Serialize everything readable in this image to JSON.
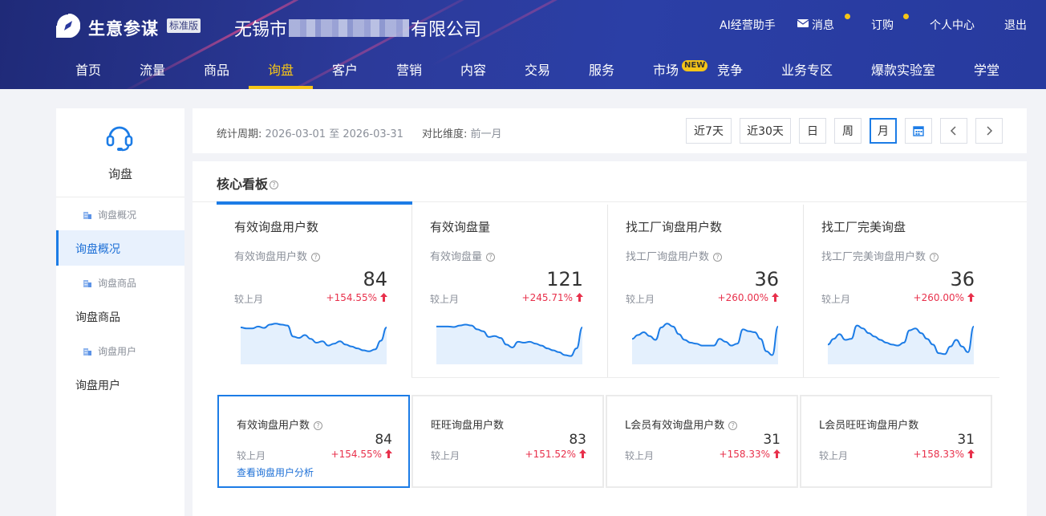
{
  "header": {
    "brand": "生意参谋",
    "edition": "标准版",
    "company_prefix": "无锡市",
    "company_suffix": "有限公司",
    "right": {
      "ai": "AI经营助手",
      "messages": "消息",
      "order": "订购",
      "personal": "个人中心",
      "logout": "退出"
    }
  },
  "nav": {
    "items": [
      "首页",
      "流量",
      "商品",
      "询盘",
      "客户",
      "营销",
      "内容",
      "交易",
      "服务",
      "市场",
      "竞争",
      "业务专区",
      "爆款实验室",
      "学堂"
    ],
    "active": "询盘",
    "new_badge": "NEW"
  },
  "sidebar": {
    "title": "询盘",
    "items": [
      {
        "label": "询盘概况",
        "type": "sub"
      },
      {
        "label": "询盘概况",
        "type": "main",
        "active": true
      },
      {
        "label": "询盘商品",
        "type": "sub"
      },
      {
        "label": "询盘商品",
        "type": "main"
      },
      {
        "label": "询盘用户",
        "type": "sub"
      },
      {
        "label": "询盘用户",
        "type": "main"
      }
    ]
  },
  "filter": {
    "period_label": "统计周期:",
    "period_value": "2026-03-01 至 2026-03-31",
    "compare_label": "对比维度:",
    "compare_value": "前一月",
    "buttons": [
      "近7天",
      "近30天",
      "日",
      "周",
      "月"
    ],
    "active_button": "月"
  },
  "core": {
    "title": "核心看板",
    "cards": [
      {
        "title": "有效询盘用户数",
        "subtitle": "有效询盘用户数",
        "value": "84",
        "compare_label": "较上月",
        "change": "+154.55%",
        "trend": [
          0.74,
          0.72,
          0.72,
          0.76,
          0.73,
          0.8,
          0.82,
          0.8,
          0.78,
          0.55,
          0.52,
          0.58,
          0.5,
          0.42,
          0.45,
          0.36,
          0.4,
          0.45,
          0.38,
          0.34,
          0.3,
          0.26,
          0.24,
          0.28,
          0.46,
          0.74
        ]
      },
      {
        "title": "有效询盘量",
        "subtitle": "有效询盘量",
        "value": "121",
        "compare_label": "较上月",
        "change": "+245.71%",
        "trend": [
          0.76,
          0.76,
          0.76,
          0.75,
          0.78,
          0.8,
          0.78,
          0.7,
          0.66,
          0.54,
          0.56,
          0.52,
          0.38,
          0.32,
          0.44,
          0.42,
          0.44,
          0.4,
          0.36,
          0.3,
          0.26,
          0.22,
          0.16,
          0.14,
          0.3,
          0.74
        ]
      },
      {
        "title": "找工厂询盘用户数",
        "subtitle": "找工厂询盘用户数",
        "value": "36",
        "compare_label": "较上月",
        "change": "+260.00%",
        "trend": [
          0.5,
          0.58,
          0.64,
          0.56,
          0.48,
          0.74,
          0.82,
          0.76,
          0.6,
          0.48,
          0.42,
          0.4,
          0.36,
          0.36,
          0.36,
          0.5,
          0.44,
          0.36,
          0.4,
          0.7,
          0.66,
          0.64,
          0.5,
          0.24,
          0.16,
          0.76
        ]
      },
      {
        "title": "找工厂完美询盘",
        "subtitle": "找工厂完美询盘用户数",
        "value": "36",
        "compare_label": "较上月",
        "change": "+260.00%",
        "trend": [
          0.38,
          0.5,
          0.6,
          0.48,
          0.5,
          0.78,
          0.72,
          0.62,
          0.55,
          0.48,
          0.42,
          0.38,
          0.36,
          0.42,
          0.68,
          0.72,
          0.62,
          0.5,
          0.38,
          0.2,
          0.18,
          0.34,
          0.48,
          0.34,
          0.22,
          0.76
        ]
      }
    ]
  },
  "small_cards": [
    {
      "title": "有效询盘用户数",
      "value": "84",
      "compare_label": "较上月",
      "change": "+154.55%",
      "link": "查看询盘用户分析",
      "help": true
    },
    {
      "title": "旺旺询盘用户数",
      "value": "83",
      "compare_label": "较上月",
      "change": "+151.52%",
      "help": false
    },
    {
      "title": "L会员有效询盘用户数",
      "value": "31",
      "compare_label": "较上月",
      "change": "+158.33%",
      "help": true
    },
    {
      "title": "L会员旺旺询盘用户数",
      "value": "31",
      "compare_label": "较上月",
      "change": "+158.33%",
      "help": false
    }
  ],
  "colors": {
    "accent": "#1c7ce6",
    "up": "#e8304b",
    "header": "#2b3a9f",
    "highlight": "#f5c518"
  }
}
